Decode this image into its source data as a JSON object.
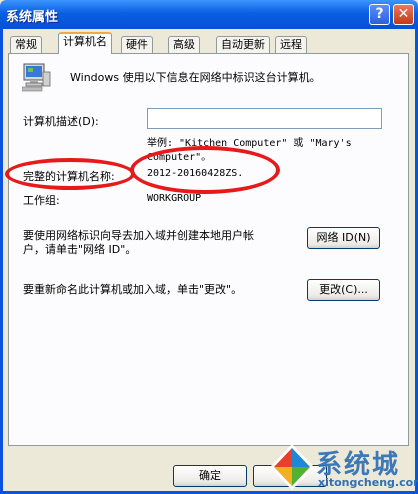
{
  "window": {
    "title": "系统属性",
    "help_glyph": "?",
    "close_glyph": "✕"
  },
  "tabs": [
    {
      "label": "常规",
      "active": false
    },
    {
      "label": "计算机名",
      "active": true
    },
    {
      "label": "硬件",
      "active": false
    },
    {
      "label": "高级",
      "active": false
    },
    {
      "label": "自动更新",
      "active": false
    },
    {
      "label": "远程",
      "active": false
    }
  ],
  "panel": {
    "intro": "Windows 使用以下信息在网络中标识这台计算机。",
    "desc_label": "计算机描述(D):",
    "desc_value": "",
    "example_line1": "举例: \"Kitchen Computer\" 或 \"Mary's",
    "example_line2": "Computer\"。",
    "fullname_label": "完整的计算机名称:",
    "fullname_value": "2012-20160428ZS.",
    "workgroup_label": "工作组:",
    "workgroup_value": "WORKGROUP",
    "netid_text_1": "要使用网络标识向导去加入域并创建本地用户帐",
    "netid_text_2": "户，请单击\"网络 ID\"。",
    "netid_button": "网络 ID(N)",
    "change_text": "要重新命名此计算机或加入域，单击\"更改\"。",
    "change_button": "更改(C)..."
  },
  "footer": {
    "ok_button": "确定"
  },
  "watermark": {
    "brand": "系统城",
    "url": "xitongcheng.com"
  },
  "colors": {
    "titlebar": "#0a5fe2",
    "annotation": "#e8191b",
    "tab_highlight": "#f3a847"
  }
}
